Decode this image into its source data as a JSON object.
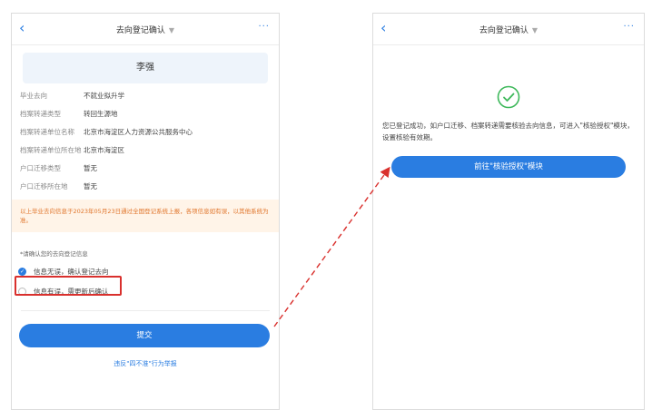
{
  "left": {
    "nav": {
      "back": "‹",
      "title": "去向登记确认",
      "caret": "▼",
      "more": "···"
    },
    "name": "李强",
    "fields": [
      {
        "label": "毕业去向",
        "value": "不就业拟升学"
      },
      {
        "label": "档案转递类型",
        "value": "转回生源地"
      },
      {
        "label": "档案转递单位名称",
        "value": "北京市海淀区人力资源公共服务中心"
      },
      {
        "label": "档案转递单位所在地",
        "value": "北京市海淀区"
      },
      {
        "label": "户口迁移类型",
        "value": "暂无"
      },
      {
        "label": "户口迁移所在地",
        "value": "暂无"
      }
    ],
    "notice": "以上毕业去向信息于2023年05月23日通过全国登记系统上报，各项信息如有误，以其他系统为准。",
    "confirm_label": "*请确认您的去向登记信息",
    "options": [
      {
        "label": "信息无误，确认登记去向",
        "checked": true
      },
      {
        "label": "信息有误，需更新后确认",
        "checked": false
      }
    ],
    "submit": "提交",
    "link": "违反\"四不准\"行为举报"
  },
  "right": {
    "nav": {
      "back": "‹",
      "title": "去向登记确认",
      "caret": "▼",
      "more": "···"
    },
    "success_text": "您已登记成功，如户口迁移、档案转递需要核验去向信息，可进入\"核验授权\"模块，设置核验有效期。",
    "goto_button": "前往\"核验授权\"模块"
  },
  "colors": {
    "primary": "#2a7de1",
    "success": "#3db85a",
    "alert": "#d9302d",
    "notice_text": "#e0752b"
  }
}
